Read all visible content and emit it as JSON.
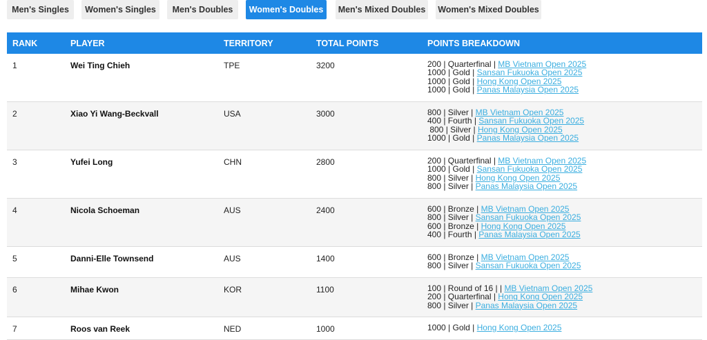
{
  "tabs": [
    {
      "label": "Men's Singles",
      "active": false
    },
    {
      "label": "Women's Singles",
      "active": false
    },
    {
      "label": "Men's Doubles",
      "active": false
    },
    {
      "label": "Women's Doubles",
      "active": true
    },
    {
      "label": "Men's Mixed Doubles",
      "active": false
    },
    {
      "label": "Women's Mixed Doubles",
      "active": false
    }
  ],
  "colors": {
    "accent": "#1e88e5",
    "link": "#3aaee0",
    "alt_row": "#f5f5f5"
  },
  "table": {
    "headers": {
      "rank": "RANK",
      "player": "PLAYER",
      "territory": "TERRITORY",
      "total": "TOTAL POINTS",
      "breakdown": "POINTS BREAKDOWN"
    },
    "rows": [
      {
        "rank": "1",
        "player": "Wei Ting Chieh",
        "territory": "TPE",
        "total": "3200",
        "breakdown": [
          {
            "prefix": "200 | Quarterfinal | ",
            "event": "MB Vietnam Open 2025"
          },
          {
            "prefix": "1000 | Gold | ",
            "event": "Sansan Fukuoka Open 2025"
          },
          {
            "prefix": "1000 | Gold | ",
            "event": "Hong Kong Open 2025"
          },
          {
            "prefix": "1000 | Gold | ",
            "event": "Panas Malaysia Open 2025"
          }
        ]
      },
      {
        "rank": "2",
        "player": "Xiao Yi Wang-Beckvall",
        "territory": "USA",
        "total": "3000",
        "breakdown": [
          {
            "prefix": "800 | Silver | ",
            "event": "MB Vietnam Open 2025"
          },
          {
            "prefix": "400 | Fourth | ",
            "event": "Sansan Fukuoka Open 2025"
          },
          {
            "prefix": " 800 | Silver | ",
            "event": "Hong Kong Open 2025"
          },
          {
            "prefix": "1000 | Gold | ",
            "event": "Panas Malaysia Open 2025"
          }
        ]
      },
      {
        "rank": "3",
        "player": "Yufei Long",
        "territory": "CHN",
        "total": "2800",
        "breakdown": [
          {
            "prefix": "200 | Quarterfinal | ",
            "event": "MB Vietnam Open 2025"
          },
          {
            "prefix": "1000 | Gold | ",
            "event": "Sansan Fukuoka Open 2025"
          },
          {
            "prefix": "800 | Silver | ",
            "event": "Hong Kong Open 2025"
          },
          {
            "prefix": "800 | Silver | ",
            "event": "Panas Malaysia Open 2025"
          }
        ]
      },
      {
        "rank": "4",
        "player": "Nicola Schoeman",
        "territory": "AUS",
        "total": "2400",
        "breakdown": [
          {
            "prefix": "600 | Bronze | ",
            "event": "MB Vietnam Open 2025"
          },
          {
            "prefix": "800 | Silver | ",
            "event": "Sansan Fukuoka Open 2025"
          },
          {
            "prefix": "600 | Bronze | ",
            "event": "Hong Kong Open 2025"
          },
          {
            "prefix": "400 | Fourth | ",
            "event": "Panas Malaysia Open 2025"
          }
        ]
      },
      {
        "rank": "5",
        "player": "Danni-Elle Townsend",
        "territory": "AUS",
        "total": "1400",
        "breakdown": [
          {
            "prefix": "600 | Bronze | ",
            "event": "MB Vietnam Open 2025"
          },
          {
            "prefix": "800 | Silver | ",
            "event": "Sansan Fukuoka Open 2025"
          }
        ]
      },
      {
        "rank": "6",
        "player": "Mihae Kwon",
        "territory": "KOR",
        "total": "1100",
        "breakdown": [
          {
            "prefix": "100 | Round of 16 | | ",
            "event": "MB Vietnam Open 2025"
          },
          {
            "prefix": "200 | Quarterfinal | ",
            "event": "Hong Kong Open 2025"
          },
          {
            "prefix": "800 | Silver | ",
            "event": "Panas Malaysia Open 2025"
          }
        ]
      },
      {
        "rank": "7",
        "player": "Roos van Reek",
        "territory": "NED",
        "total": "1000",
        "breakdown": [
          {
            "prefix": "1000 | Gold | ",
            "event": "Hong Kong Open 2025"
          }
        ]
      }
    ]
  }
}
